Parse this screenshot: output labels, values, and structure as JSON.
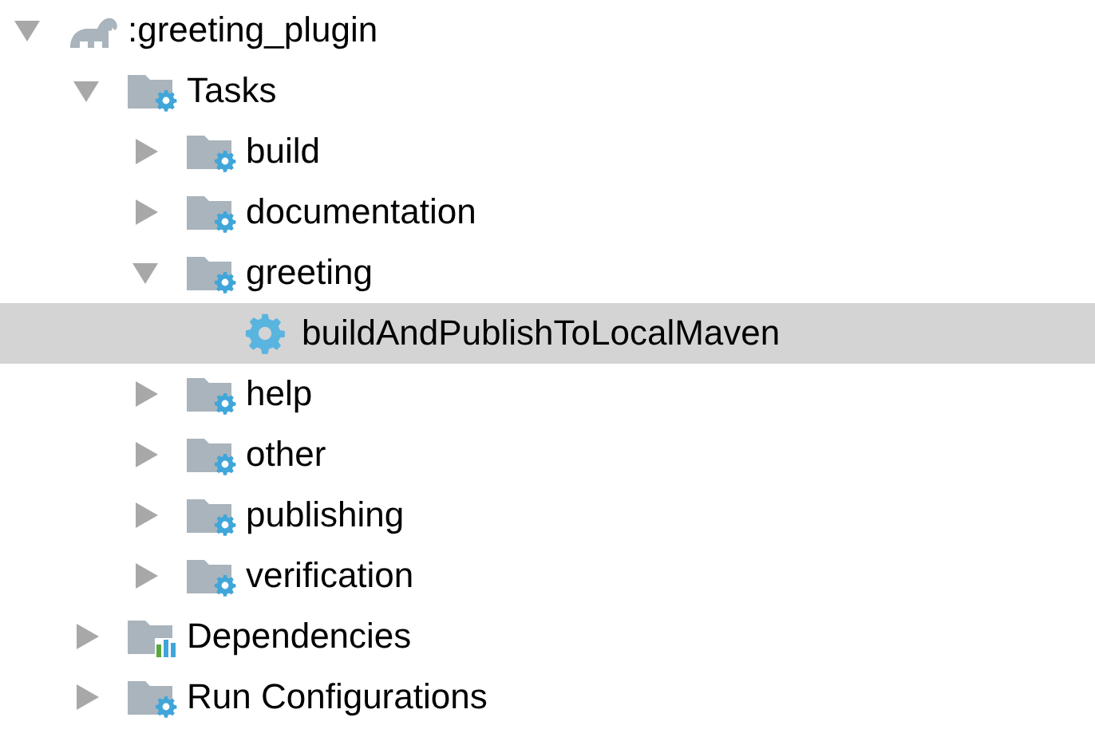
{
  "tree": [
    {
      "label": ":greeting_plugin",
      "kind": "project",
      "expanded": true,
      "selected": false,
      "children": [
        {
          "label": "Tasks",
          "kind": "folder",
          "expanded": true,
          "selected": false,
          "children": [
            {
              "label": "build",
              "kind": "folder",
              "expanded": false,
              "selected": false
            },
            {
              "label": "documentation",
              "kind": "folder",
              "expanded": false,
              "selected": false
            },
            {
              "label": "greeting",
              "kind": "folder",
              "expanded": true,
              "selected": false,
              "children": [
                {
                  "label": "buildAndPublishToLocalMaven",
                  "kind": "task",
                  "selected": true
                }
              ]
            },
            {
              "label": "help",
              "kind": "folder",
              "expanded": false,
              "selected": false
            },
            {
              "label": "other",
              "kind": "folder",
              "expanded": false,
              "selected": false
            },
            {
              "label": "publishing",
              "kind": "folder",
              "expanded": false,
              "selected": false
            },
            {
              "label": "verification",
              "kind": "folder",
              "expanded": false,
              "selected": false
            }
          ]
        },
        {
          "label": "Dependencies",
          "kind": "dependencies",
          "expanded": false,
          "selected": false
        },
        {
          "label": "Run Configurations",
          "kind": "folder",
          "expanded": false,
          "selected": false
        }
      ]
    }
  ]
}
